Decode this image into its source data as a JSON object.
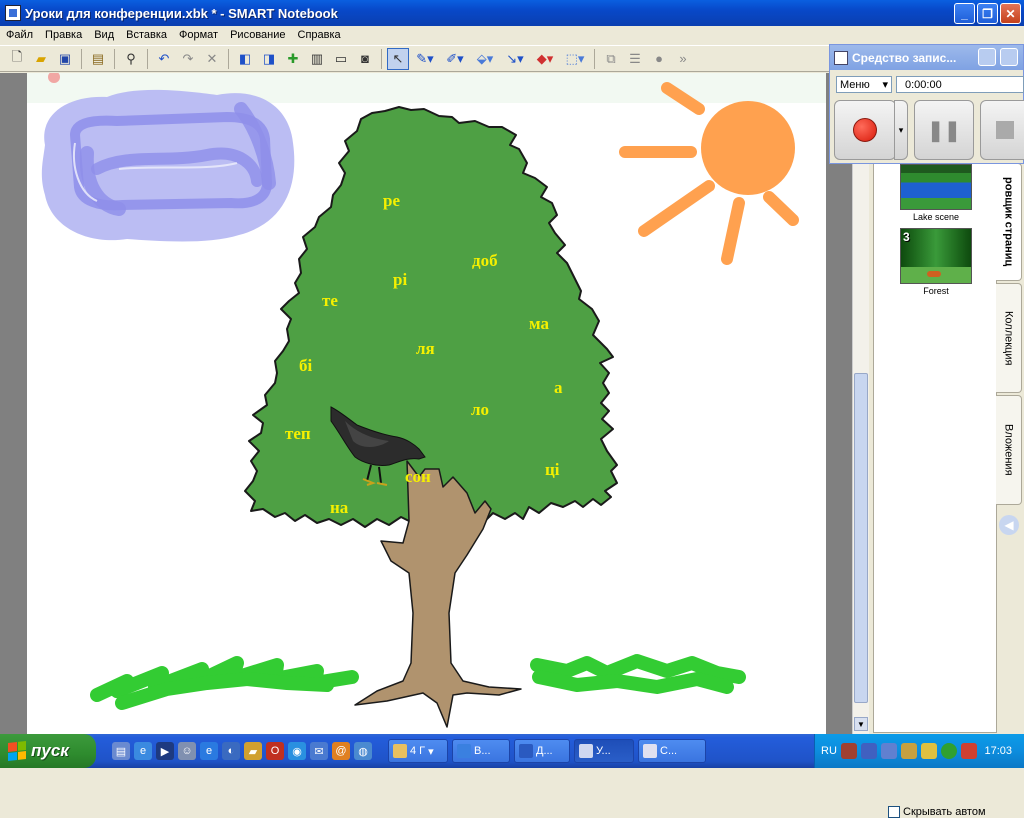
{
  "window": {
    "title": "Уроки для конференции.xbk * - SMART Notebook"
  },
  "menu": [
    "Файл",
    "Правка",
    "Вид",
    "Вставка",
    "Формат",
    "Рисование",
    "Справка"
  ],
  "canvas": {
    "syllables": [
      "ре",
      "рі",
      "доб",
      "те",
      "ма",
      "ля",
      "бі",
      "а",
      "ло",
      "теп",
      "ці",
      "сон",
      "на"
    ]
  },
  "recorder": {
    "title": "Средство запис...",
    "menu_label": "Меню",
    "time": "0:00:00"
  },
  "page_sorter": {
    "tab_label": "ровщик страниц",
    "pages": [
      {
        "number": "",
        "caption": "Lake scene"
      },
      {
        "number": "3",
        "caption": "Forest"
      }
    ],
    "autohide_label": "Скрывать автом"
  },
  "side_tabs": [
    "Коллекция",
    "Вложения"
  ],
  "taskbar": {
    "start_label": "пуск",
    "tasks": [
      "4 Г",
      "В...",
      "Д...",
      "У...",
      "С..."
    ],
    "lang": "RU",
    "clock": "17:03"
  },
  "colors": {
    "tree": "#4EA044",
    "trunk": "#B0936E",
    "sun": "#FFA14F",
    "cloud": "#B7B9F2",
    "grass": "#33CC33",
    "syllable_text": "#F5F000"
  }
}
